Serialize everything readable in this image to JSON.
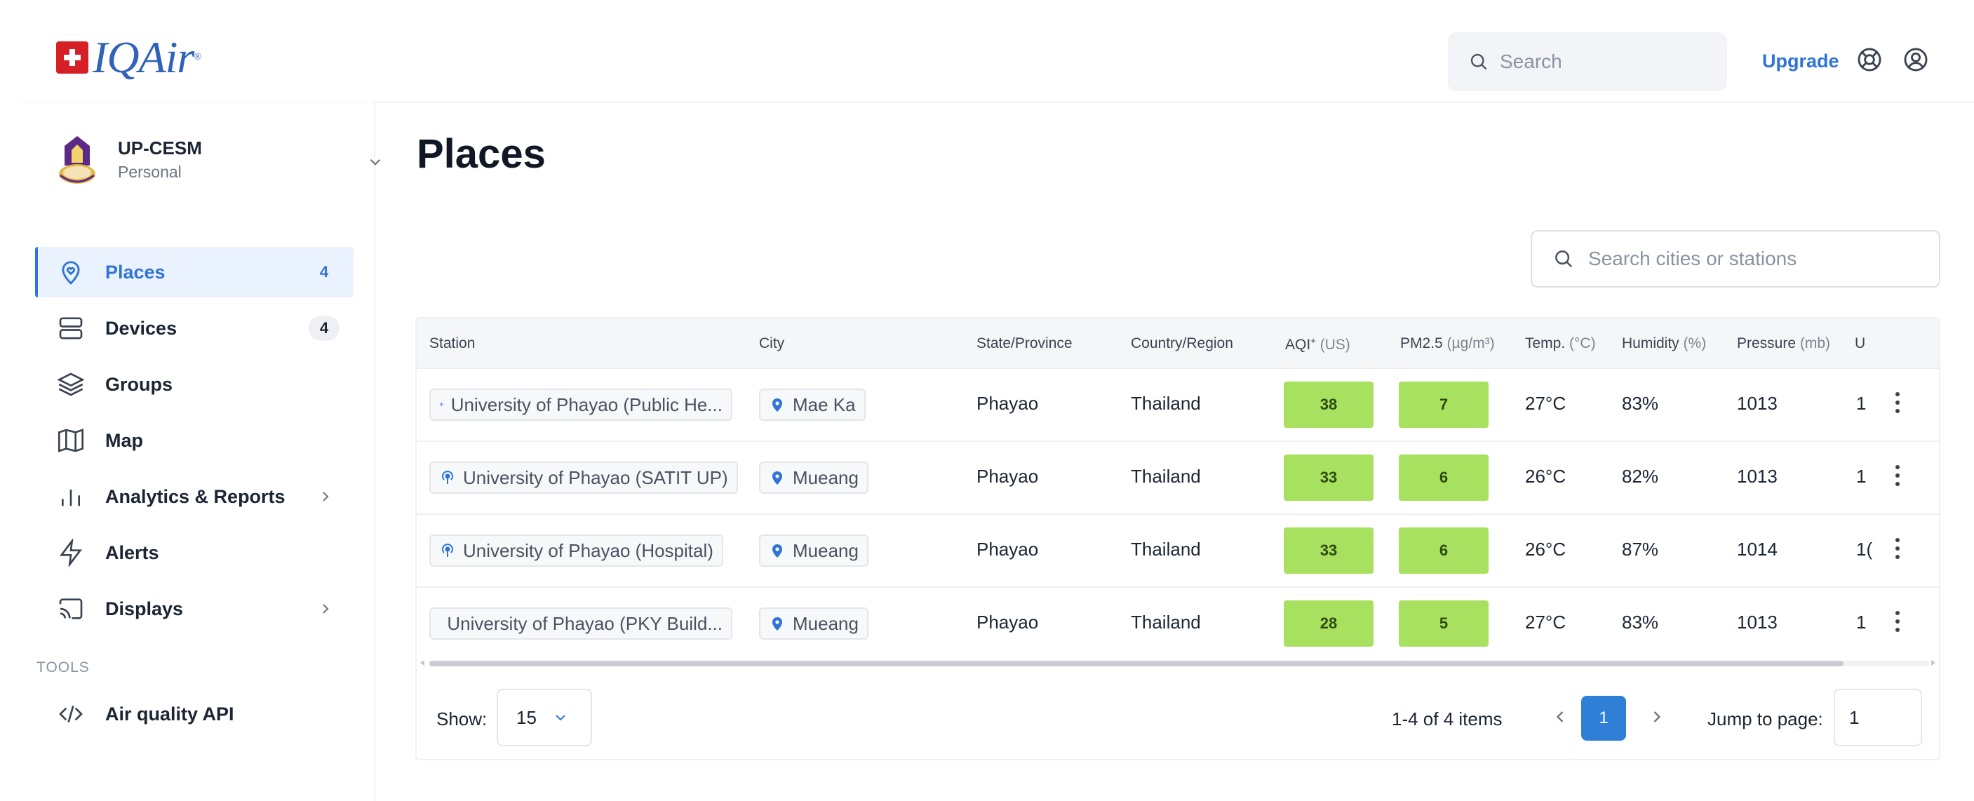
{
  "header": {
    "logo_text": "IQAir",
    "search_placeholder": "Search",
    "upgrade_label": "Upgrade",
    "help_icon": "lifebuoy-icon",
    "account_icon": "user-circle-icon"
  },
  "organization": {
    "name": "UP-CESM",
    "type": "Personal"
  },
  "sidebar": {
    "items": [
      {
        "label": "Places",
        "count": "4",
        "icon": "location-heart-icon",
        "active": true
      },
      {
        "label": "Devices",
        "count": "4",
        "icon": "server-icon"
      },
      {
        "label": "Groups",
        "icon": "layers-icon"
      },
      {
        "label": "Map",
        "icon": "map-icon"
      },
      {
        "label": "Analytics & Reports",
        "icon": "bar-chart-icon",
        "has_submenu": true
      },
      {
        "label": "Alerts",
        "icon": "lightning-icon"
      },
      {
        "label": "Displays",
        "icon": "cast-icon",
        "has_submenu": true
      }
    ],
    "tools_label": "TOOLS",
    "api_label": "Air quality API"
  },
  "main": {
    "title": "Places",
    "search_placeholder": "Search cities or stations"
  },
  "table": {
    "columns": {
      "station": "Station",
      "city": "City",
      "state": "State/Province",
      "country": "Country/Region",
      "aqi": "AQI",
      "aqi_sup": "+",
      "aqi_unit": "(US)",
      "pm25": "PM2.5",
      "pm25_unit": "(µg/m³)",
      "temp": "Temp.",
      "temp_unit": "(°C)",
      "humidity": "Humidity",
      "humidity_unit": "(%)",
      "pressure": "Pressure",
      "pressure_unit": "(mb)",
      "truncated": "U"
    },
    "rows": [
      {
        "station": "University of Phayao (Public He...",
        "city": "Mae Ka",
        "state": "Phayao",
        "country": "Thailand",
        "aqi": "38",
        "pm25": "7",
        "temp": "27°C",
        "humidity": "83%",
        "pressure": "1013",
        "truncated": "1"
      },
      {
        "station": "University of Phayao (SATIT UP)",
        "city": "Mueang",
        "state": "Phayao",
        "country": "Thailand",
        "aqi": "33",
        "pm25": "6",
        "temp": "26°C",
        "humidity": "82%",
        "pressure": "1013",
        "truncated": "1"
      },
      {
        "station": "University of Phayao (Hospital)",
        "city": "Mueang",
        "state": "Phayao",
        "country": "Thailand",
        "aqi": "33",
        "pm25": "6",
        "temp": "26°C",
        "humidity": "87%",
        "pressure": "1014",
        "truncated": "1("
      },
      {
        "station": "University of Phayao (PKY Build...",
        "city": "Mueang",
        "state": "Phayao",
        "country": "Thailand",
        "aqi": "28",
        "pm25": "5",
        "temp": "27°C",
        "humidity": "83%",
        "pressure": "1013",
        "truncated": "1"
      }
    ]
  },
  "pagination": {
    "show_label": "Show:",
    "page_size": "15",
    "range_text": "1-4 of 4 items",
    "current_page": "1",
    "jump_label": "Jump to page:",
    "jump_value": "1"
  },
  "colors": {
    "accent": "#2f74d6",
    "aqi_good": "#a8e05f",
    "logo_red": "#d71f26"
  }
}
